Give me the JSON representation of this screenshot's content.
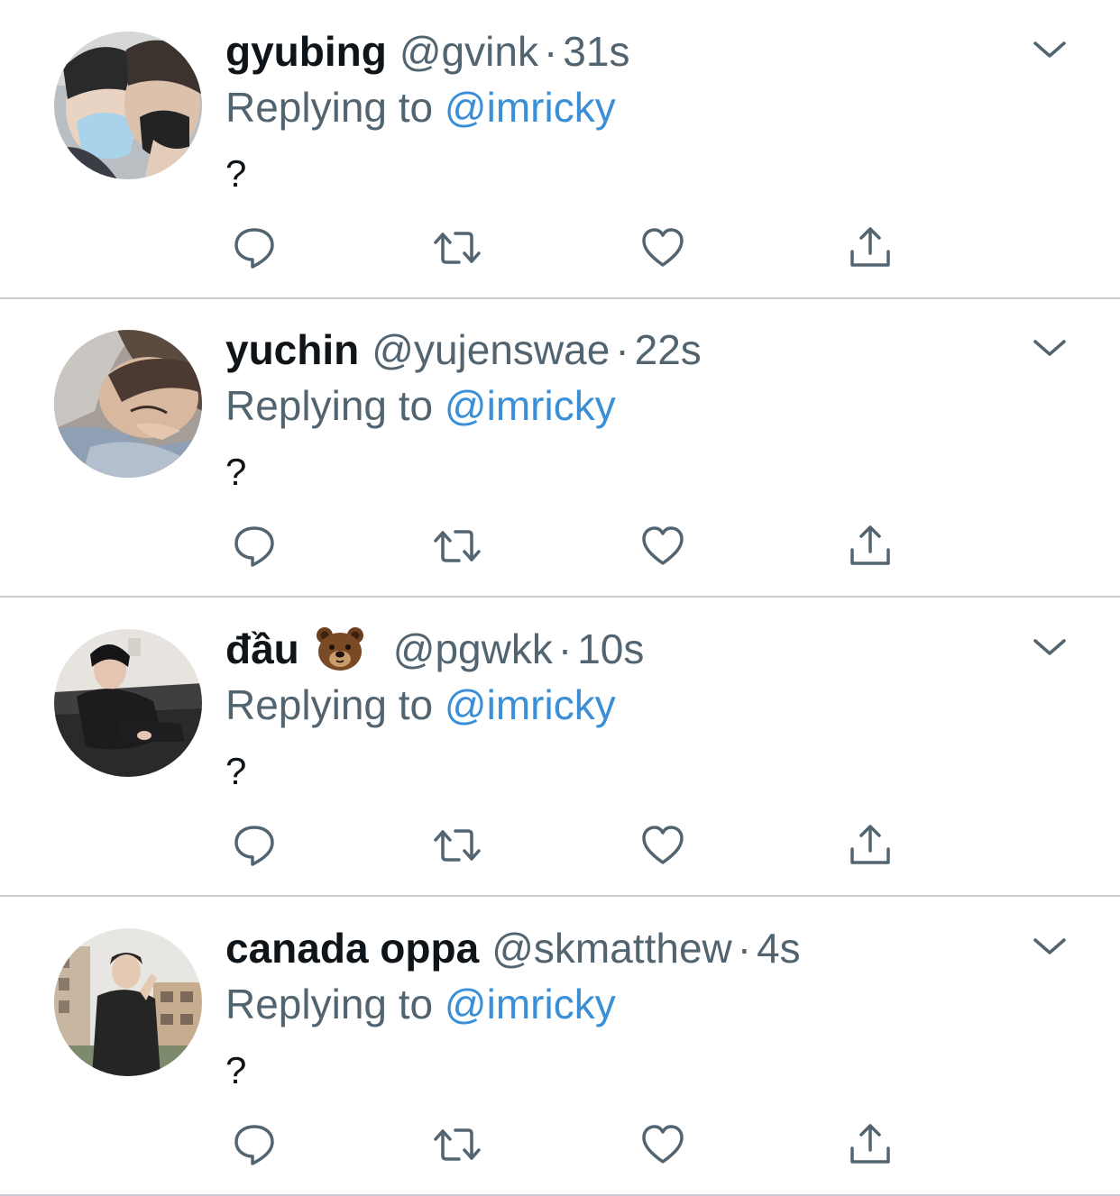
{
  "colors": {
    "name": "#0f1419",
    "secondary": "#536471",
    "mention": "#3a8fd6",
    "divider": "#c8ccd0",
    "icon": "#536471"
  },
  "tweets": [
    {
      "name": "gyubing",
      "emoji": "",
      "handle": "@gvink",
      "dot": "·",
      "time": "31s",
      "reply_prefix": "Replying to ",
      "reply_to": "@imricky",
      "text": "?"
    },
    {
      "name": "yuchin",
      "emoji": "",
      "handle": "@yujenswae",
      "dot": "·",
      "time": "22s",
      "reply_prefix": "Replying to ",
      "reply_to": "@imricky",
      "text": "?"
    },
    {
      "name": "đầu",
      "emoji": "bear-face",
      "handle": "@pgwkk",
      "dot": "·",
      "time": "10s",
      "reply_prefix": "Replying to ",
      "reply_to": "@imricky",
      "text": "?"
    },
    {
      "name": "canada oppa",
      "emoji": "",
      "handle": "@skmatthew",
      "dot": "·",
      "time": "4s",
      "reply_prefix": "Replying to ",
      "reply_to": "@imricky",
      "text": "?"
    }
  ],
  "icons": {
    "more": "chevron-down-icon",
    "reply": "reply-icon",
    "retweet": "retweet-icon",
    "like": "heart-icon",
    "share": "share-icon",
    "avatar": "avatar-photo"
  }
}
